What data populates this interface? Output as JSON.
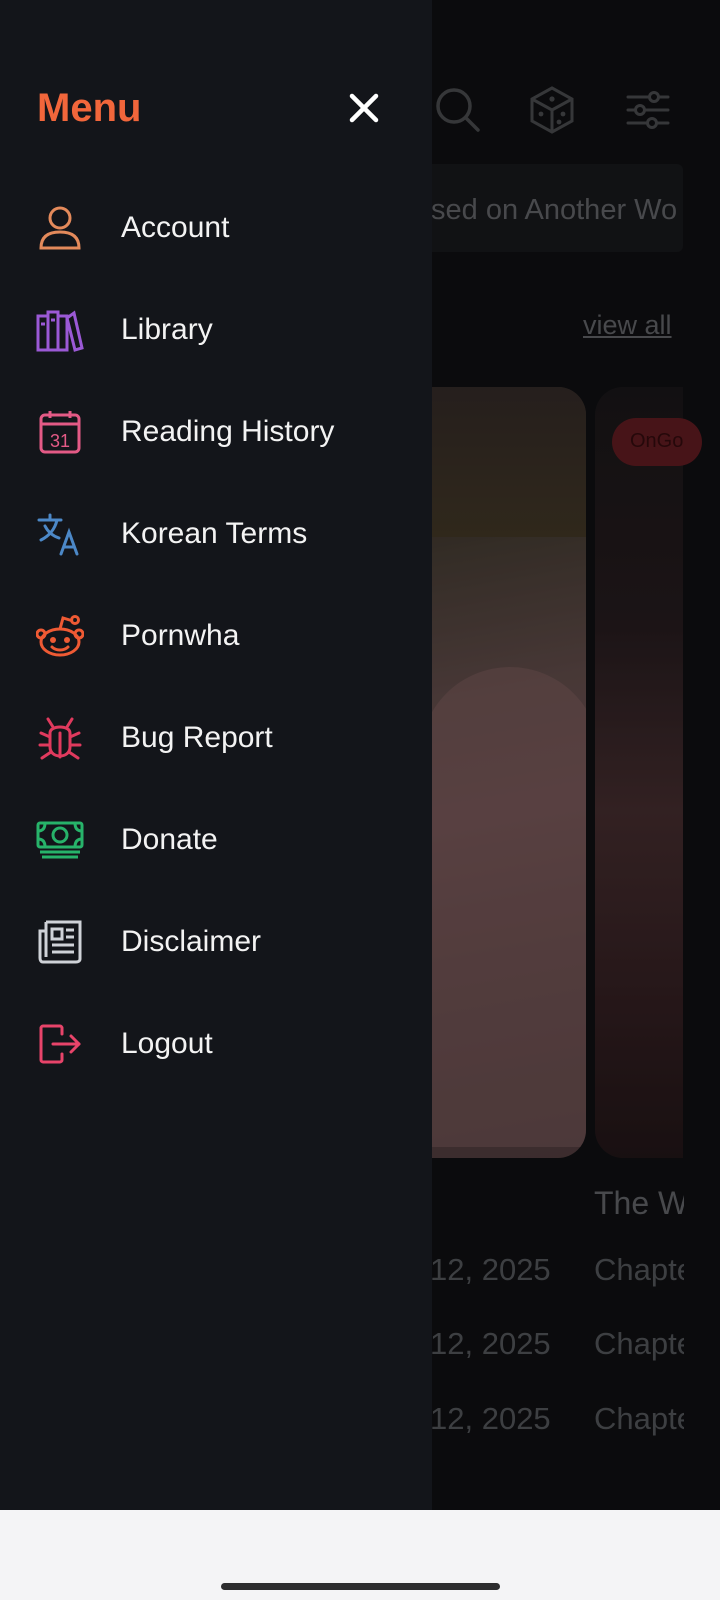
{
  "drawer": {
    "title": "Menu",
    "close_icon": "close-icon",
    "accent_color": "#f2663b",
    "items": [
      {
        "label": "Account",
        "icon": "user-icon",
        "color": "#e48a5b"
      },
      {
        "label": "Library",
        "icon": "books-icon",
        "color": "#9b59d6"
      },
      {
        "label": "Reading History",
        "icon": "calendar-icon",
        "color": "#e45a86"
      },
      {
        "label": "Korean Terms",
        "icon": "translate-icon",
        "color": "#4c88c7"
      },
      {
        "label": "Pornwha",
        "icon": "reddit-icon",
        "color": "#ef5a34"
      },
      {
        "label": "Bug Report",
        "icon": "bug-icon",
        "color": "#e03a5e"
      },
      {
        "label": "Donate",
        "icon": "money-icon",
        "color": "#27b36a"
      },
      {
        "label": "Disclaimer",
        "icon": "newspaper-icon",
        "color": "#cfd2d8"
      },
      {
        "label": "Logout",
        "icon": "logout-icon",
        "color": "#e8446a"
      }
    ]
  },
  "background": {
    "top_icons": [
      "search-icon",
      "dice-icon",
      "filter-icon"
    ],
    "banner_text": "sed on Another Wo",
    "view_all": "view all",
    "badge": "OnGo",
    "card_title": "The W",
    "rows": [
      {
        "date": "12, 2025",
        "chapter": "Chapte"
      },
      {
        "date": "12, 2025",
        "chapter": "Chapte"
      },
      {
        "date": "12, 2025",
        "chapter": "Chapte"
      }
    ]
  }
}
